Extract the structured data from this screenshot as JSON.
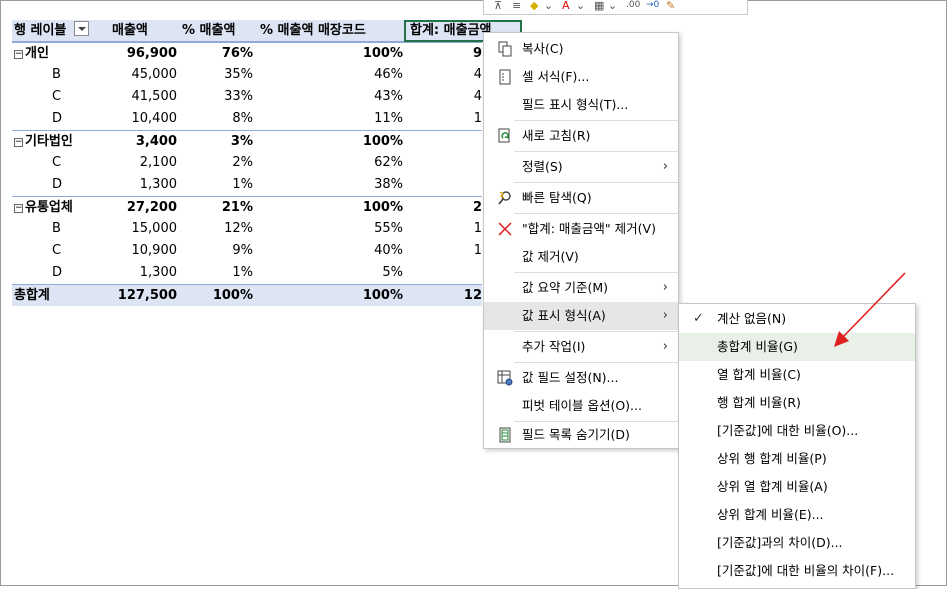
{
  "pivot": {
    "headers": {
      "row_label": "행 레이블",
      "sales": "매출액",
      "pct_sales": "% 매출액",
      "pct_sales_store": "% 매출액 매장코드",
      "sum_field": "합계: 매출금액"
    },
    "rows": [
      {
        "type": "grp",
        "label": "개인",
        "v1": "96,900",
        "v2": "76%",
        "v3": "100%",
        "v4": "9"
      },
      {
        "type": "item",
        "label": "B",
        "v1": "45,000",
        "v2": "35%",
        "v3": "46%",
        "v4": "4"
      },
      {
        "type": "item",
        "label": "C",
        "v1": "41,500",
        "v2": "33%",
        "v3": "43%",
        "v4": "4"
      },
      {
        "type": "item",
        "label": "D",
        "v1": "10,400",
        "v2": "8%",
        "v3": "11%",
        "v4": "1"
      },
      {
        "type": "grp",
        "label": "기타법인",
        "v1": "3,400",
        "v2": "3%",
        "v3": "100%",
        "v4": ""
      },
      {
        "type": "item",
        "label": "C",
        "v1": "2,100",
        "v2": "2%",
        "v3": "62%",
        "v4": ""
      },
      {
        "type": "item",
        "label": "D",
        "v1": "1,300",
        "v2": "1%",
        "v3": "38%",
        "v4": ""
      },
      {
        "type": "grp",
        "label": "유통업체",
        "v1": "27,200",
        "v2": "21%",
        "v3": "100%",
        "v4": "2"
      },
      {
        "type": "item",
        "label": "B",
        "v1": "15,000",
        "v2": "12%",
        "v3": "55%",
        "v4": "1"
      },
      {
        "type": "item",
        "label": "C",
        "v1": "10,900",
        "v2": "9%",
        "v3": "40%",
        "v4": "1"
      },
      {
        "type": "item",
        "label": "D",
        "v1": "1,300",
        "v2": "1%",
        "v3": "5%",
        "v4": ""
      },
      {
        "type": "grand",
        "label": "총합계",
        "v1": "127,500",
        "v2": "100%",
        "v3": "100%",
        "v4": "12"
      }
    ]
  },
  "minibar": {
    "text1": ".00",
    "text2": "→0"
  },
  "context_menu": {
    "items": [
      {
        "label": "복사(C)",
        "icon": "copy-icon"
      },
      {
        "label": "셀 서식(F)...",
        "icon": "format-cells-icon"
      },
      {
        "label": "필드 표시 형식(T)...",
        "icon": ""
      },
      {
        "label": "새로 고침(R)",
        "icon": "refresh-icon"
      },
      {
        "label": "정렬(S)",
        "icon": "",
        "submenu": true
      },
      {
        "label": "빠른 탐색(Q)",
        "icon": "quick-explore-icon"
      },
      {
        "label": "\"합계: 매출금액\" 제거(V)",
        "icon": "remove-x-icon"
      },
      {
        "label": "값 제거(V)",
        "icon": ""
      },
      {
        "label": "값 요약 기준(M)",
        "icon": "",
        "submenu": true
      },
      {
        "label": "값 표시 형식(A)",
        "icon": "",
        "submenu": true,
        "active": true
      },
      {
        "label": "추가 작업(I)",
        "icon": "",
        "submenu": true
      },
      {
        "label": "값 필드 설정(N)...",
        "icon": "field-settings-icon"
      },
      {
        "label": "피벗 테이블 옵션(O)...",
        "icon": ""
      },
      {
        "label": "필드 목록 숨기기(D)",
        "icon": "field-list-icon"
      }
    ]
  },
  "submenu": {
    "items": [
      {
        "label": "계산 없음(N)",
        "checked": true
      },
      {
        "label": "총합계 비율(G)",
        "hover": true
      },
      {
        "label": "열 합계 비율(C)"
      },
      {
        "label": "행 합계 비율(R)"
      },
      {
        "label": "[기준값]에 대한 비율(O)..."
      },
      {
        "label": "상위 행 합계 비율(P)"
      },
      {
        "label": "상위 열 합계 비율(A)"
      },
      {
        "label": "상위 합계 비율(E)..."
      },
      {
        "label": "[기준값]과의 차이(D)..."
      },
      {
        "label": "[기준값]에 대한 비율의 차이(F)..."
      }
    ]
  },
  "colors": {
    "header_bg": "#dde5f4",
    "selection": "#217346",
    "annotation_arrow": "#e02020",
    "hover": "#e8f0e8"
  }
}
